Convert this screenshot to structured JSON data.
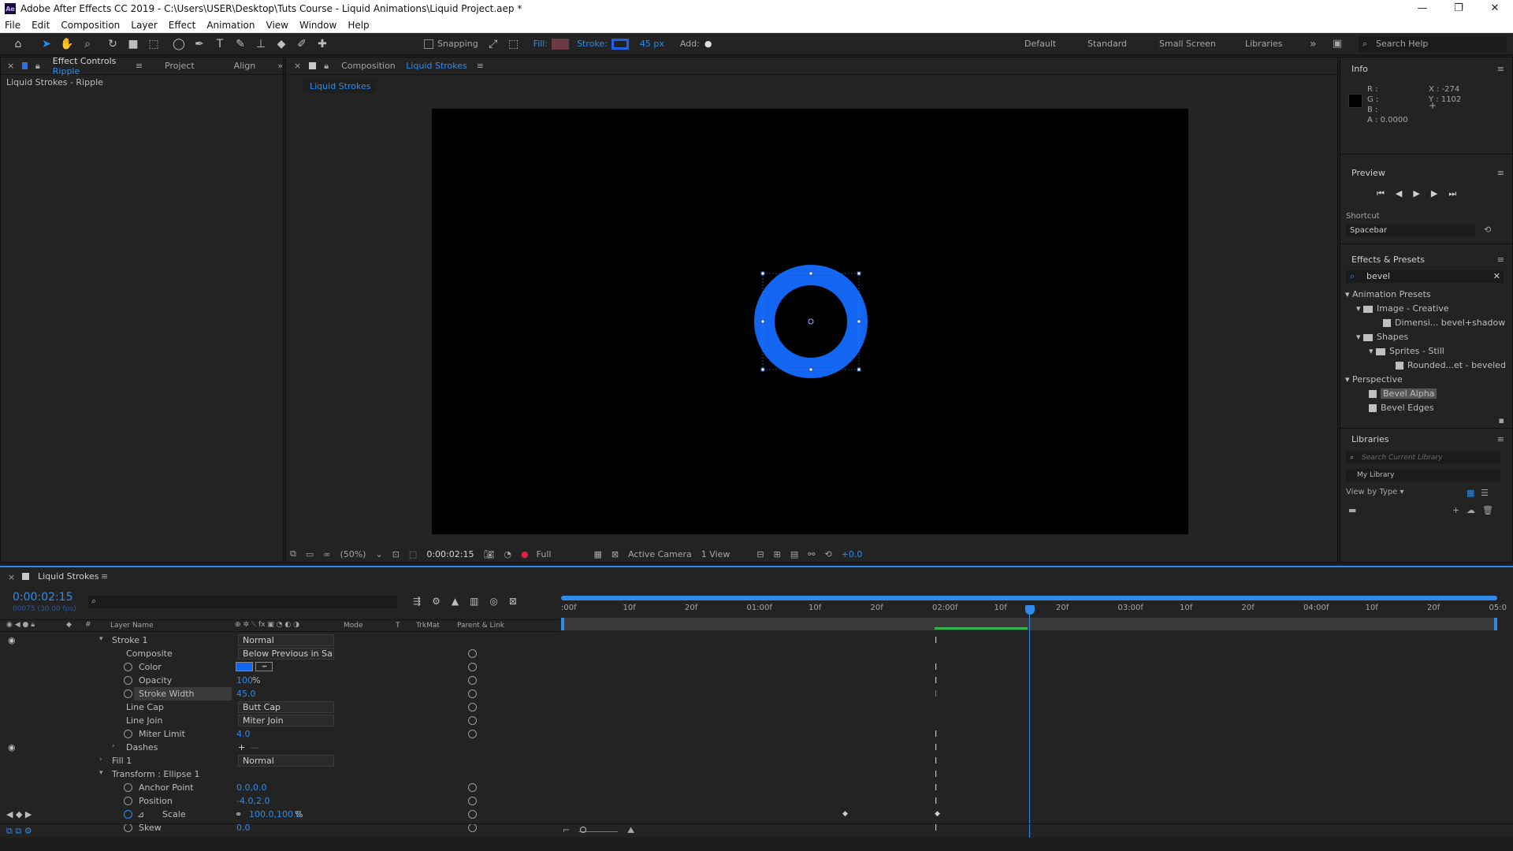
{
  "window": {
    "title": "Adobe After Effects CC 2019 - C:\\Users\\USER\\Desktop\\Tuts Course - Liquid Animations\\Liquid Project.aep *",
    "logo": "Ae",
    "minimize": "—",
    "restore": "❐",
    "close": "✕"
  },
  "menu": [
    "File",
    "Edit",
    "Composition",
    "Layer",
    "Effect",
    "Animation",
    "View",
    "Window",
    "Help"
  ],
  "toolbar": {
    "snapping": "Snapping",
    "fill": "Fill:",
    "stroke": "Stroke:",
    "stroke_px": "45 px",
    "add": "Add:",
    "fill_color": "#6b3a44",
    "stroke_color": "#1b62e8"
  },
  "workspaces": [
    "Default",
    "Standard",
    "Small Screen",
    "Libraries"
  ],
  "search_help": "Search Help",
  "left_panel": {
    "tab_effect_controls": "Effect Controls",
    "tab_effect_controls_target": "Ripple",
    "tab_project": "Project",
    "tab_align": "Align",
    "subtitle": "Liquid Strokes - Ripple"
  },
  "comp_panel": {
    "tab_prefix": "Composition",
    "tab_name": "Liquid Strokes",
    "chip": "Liquid Strokes",
    "ring_color": "#1266f1"
  },
  "view_bar": {
    "zoom": "(50%)",
    "timecode": "0:00:02:15",
    "resolution": "Full",
    "camera": "Active Camera",
    "views": "1 View",
    "exposure": "+0.0"
  },
  "info": {
    "title": "Info",
    "r": "R :",
    "g": "G :",
    "b": "B :",
    "a": "A :  0.0000",
    "x": "X : -274",
    "y": "Y : 1102"
  },
  "preview": {
    "title": "Preview",
    "shortcut_label": "Shortcut",
    "shortcut_value": "Spacebar"
  },
  "effects_presets": {
    "title": "Effects & Presets",
    "search": "bevel",
    "tree": [
      "Animation Presets",
      "Image - Creative",
      "Dimensi... bevel+shadow",
      "Shapes",
      "Sprites - Still",
      "Rounded...et - beveled",
      "Perspective",
      "Bevel Alpha",
      "Bevel Edges"
    ]
  },
  "libraries": {
    "title": "Libraries",
    "search_placeholder": "Search Current Library",
    "library": "My Library",
    "view_by": "View by Type"
  },
  "timeline": {
    "comp_name": "Liquid Strokes",
    "timecode": "0:00:02:15",
    "frame_info": "00075 (30.00 fps)",
    "col_layer": "Layer Name",
    "col_mode": "Mode",
    "col_t": "T",
    "col_trkmat": "TrkMat",
    "col_parent": "Parent & Link",
    "ruler": [
      ":00f",
      "10f",
      "20f",
      "01:00f",
      "10f",
      "20f",
      "02:00f",
      "10f",
      "20f",
      "03:00f",
      "10f",
      "20f",
      "04:00f",
      "10f",
      "20f",
      "05:0"
    ],
    "rows": {
      "stroke1": "Stroke 1",
      "stroke1_mode": "Normal",
      "composite": "Composite",
      "composite_val": "Below Previous in Sa",
      "color": "Color",
      "color_swatch": "#1266f1",
      "opacity": "Opacity",
      "opacity_val": "100",
      "opacity_unit": "%",
      "stroke_width": "Stroke Width",
      "stroke_width_val": "45.0",
      "line_cap": "Line Cap",
      "line_cap_val": "Butt Cap",
      "line_join": "Line Join",
      "line_join_val": "Miter Join",
      "miter_limit": "Miter Limit",
      "miter_limit_val": "4.0",
      "dashes": "Dashes",
      "fill1": "Fill 1",
      "fill1_mode": "Normal",
      "transform": "Transform : Ellipse 1",
      "anchor": "Anchor Point",
      "anchor_val": "0.0,0.0",
      "position": "Position",
      "position_val": "-4.0,2.0",
      "scale": "Scale",
      "scale_val": "100.0,100.0",
      "scale_unit": "%",
      "skew": "Skew",
      "skew_val": "0.0"
    }
  }
}
